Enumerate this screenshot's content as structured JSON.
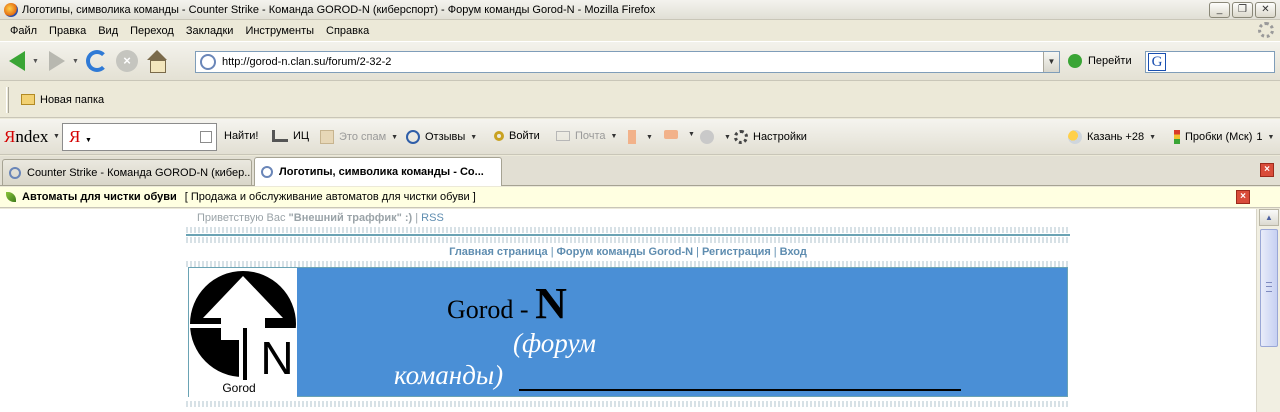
{
  "window": {
    "title": "Логотипы, символика команды - Counter Strike - Команда GOROD-N (киберспорт) - Форум команды Gorod-N - Mozilla Firefox",
    "min": "_",
    "max": "❐",
    "close": "✕"
  },
  "menu": [
    "Файл",
    "Правка",
    "Вид",
    "Переход",
    "Закладки",
    "Инструменты",
    "Справка"
  ],
  "nav": {
    "url": "http://gorod-n.clan.su/forum/2-32-2",
    "go_label": "Перейти",
    "search_value": ""
  },
  "bookmarks": {
    "folder_label": "Новая папка"
  },
  "yandex": {
    "logo_ya": "Я",
    "logo_rest": "ndex",
    "input_value": "",
    "find_label": "Найти!",
    "ic_label": "ИЦ",
    "spam_label": "Это спам",
    "reviews_label": "Отзывы",
    "login_label": "Войти",
    "mail_label": "Почта",
    "settings_label": "Настройки",
    "weather_label": "Казань +28",
    "traffic_label": "Пробки (Мск)",
    "traffic_value": "1"
  },
  "tabs": [
    {
      "label": "Counter Strike - Команда GOROD-N (кибер...",
      "active": false
    },
    {
      "label": "Логотипы, символика команды - Co...",
      "active": true
    }
  ],
  "adbar": {
    "title": "Автоматы для чистки обуви",
    "subtitle": "[ Продажа и обслуживание автоматов для чистки обуви ]"
  },
  "page": {
    "greet_prefix": "Приветствую Вас",
    "greet_user": "\"Внешний траффик\" :)",
    "greet_sep": "|",
    "rss": "RSS",
    "nav_links": [
      "Главная страница",
      "Форум команды Gorod-N",
      "Регистрация",
      "Вход"
    ],
    "logo_letter": "N",
    "logo_caption": "Gorod",
    "title_prefix": "Gorod -",
    "title_big": "N",
    "subtitle_line1": "(форум",
    "subtitle_line2": "команды)"
  },
  "colors": {
    "header_blue": "#4a8fd6",
    "link_blue": "#5f8db0",
    "ad_bg": "#ffffe1"
  }
}
